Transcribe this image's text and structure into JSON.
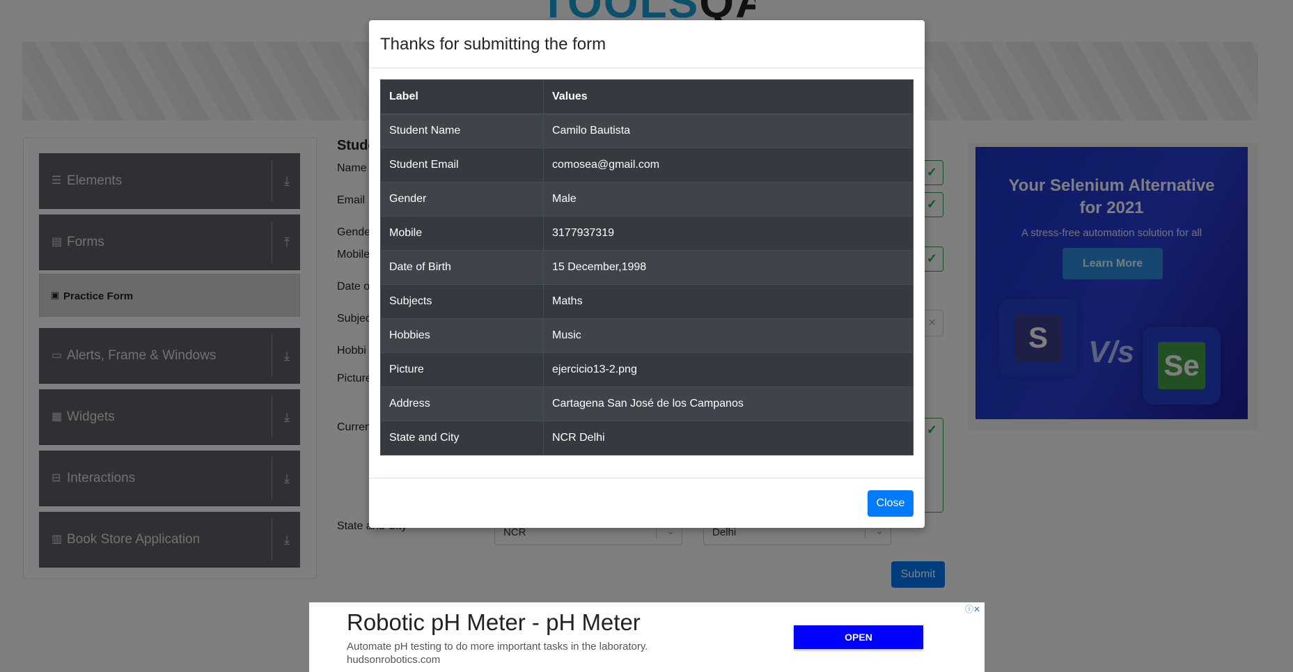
{
  "header": {
    "logo_part1": "TOOLS",
    "logo_part2": "QA"
  },
  "sidebar": {
    "groups": [
      {
        "label": "Elements",
        "icon": "menu-icon",
        "arrow": "down"
      },
      {
        "label": "Forms",
        "icon": "document-icon",
        "arrow": "up"
      },
      {
        "label": "Alerts, Frame & Windows",
        "icon": "window-icon",
        "arrow": "down"
      },
      {
        "label": "Widgets",
        "icon": "widgets-icon",
        "arrow": "down"
      },
      {
        "label": "Interactions",
        "icon": "interactions-icon",
        "arrow": "down"
      },
      {
        "label": "Book Store Application",
        "icon": "books-icon",
        "arrow": "down"
      }
    ],
    "active_item": "Practice Form"
  },
  "form": {
    "title": "Stude",
    "labels": [
      "Name",
      "Email",
      "Gende",
      "Mobile",
      "Date o",
      "Subjec",
      "Hobbi",
      "Picture",
      "Curren",
      "State and City"
    ],
    "state": "NCR",
    "city": "Delhi",
    "submit_label": "Submit"
  },
  "ad_right": {
    "title_line1": "Your Selenium Alternative",
    "title_line2": "for 2021",
    "subtitle": "A stress-free automation solution for all",
    "button": "Learn More",
    "vs": "V/s",
    "left_logo": "S",
    "right_logo": "Se"
  },
  "modal": {
    "title": "Thanks for submitting the form",
    "headers": [
      "Label",
      "Values"
    ],
    "rows": [
      {
        "label": "Student Name",
        "value": "Camilo Bautista"
      },
      {
        "label": "Student Email",
        "value": "comosea@gmail.com"
      },
      {
        "label": "Gender",
        "value": "Male"
      },
      {
        "label": "Mobile",
        "value": "3177937319"
      },
      {
        "label": "Date of Birth",
        "value": "15 December,1998"
      },
      {
        "label": "Subjects",
        "value": "Maths"
      },
      {
        "label": "Hobbies",
        "value": "Music"
      },
      {
        "label": "Picture",
        "value": "ejercicio13-2.png"
      },
      {
        "label": "Address",
        "value": "Cartagena San José de los Campanos"
      },
      {
        "label": "State and City",
        "value": "NCR Delhi"
      }
    ],
    "close_label": "Close"
  },
  "ad_bottom": {
    "title": "Robotic pH Meter - pH Meter",
    "description": "Automate pH testing to do more important tasks in the laboratory.",
    "url": "hudsonrobotics.com",
    "open_label": "OPEN",
    "adchoices": "ⓘ✕"
  },
  "colors": {
    "accent": "#007bff",
    "valid": "#28a745",
    "table_bg": "#343a40",
    "sidebar_bg": "#5e6166"
  }
}
